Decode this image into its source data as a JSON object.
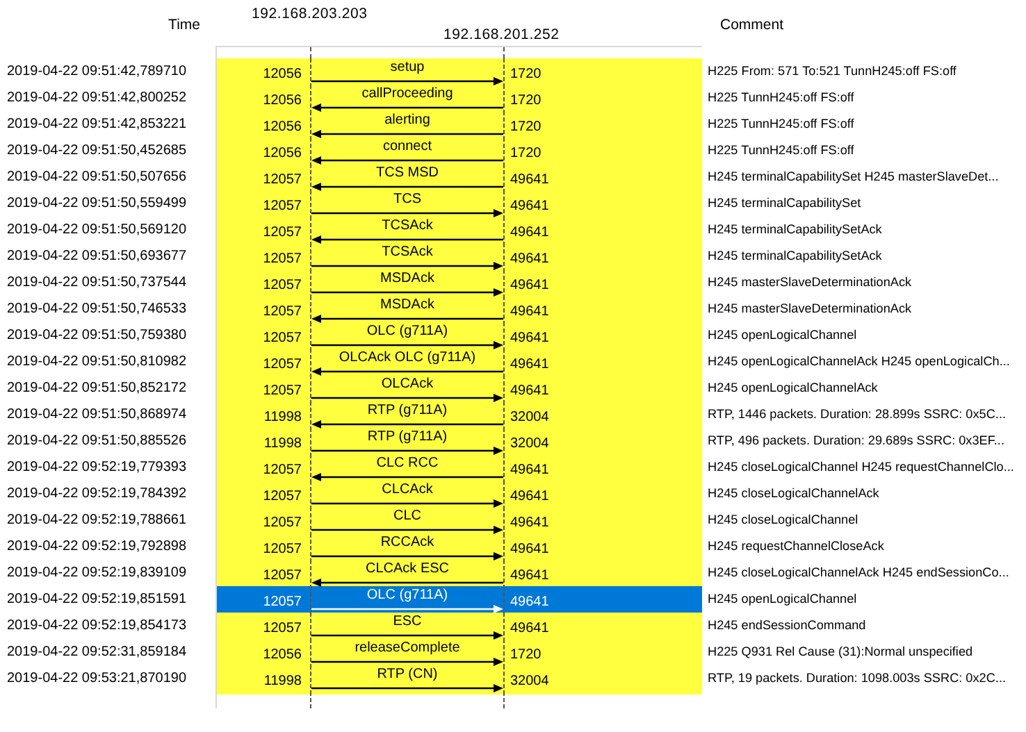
{
  "columns": {
    "time": "Time",
    "comment": "Comment"
  },
  "hosts": [
    "192.168.203.203",
    "192.168.201.252"
  ],
  "rows": [
    {
      "time": "2019-04-22 09:51:42,789710",
      "left_port": "12056",
      "label": "setup",
      "right_port": "1720",
      "kind": "right",
      "comment": "H225 From: 571 To:521  TunnH245:off FS:off",
      "selected": false
    },
    {
      "time": "2019-04-22 09:51:42,800252",
      "left_port": "12056",
      "label": "callProceeding",
      "right_port": "1720",
      "kind": "left",
      "comment": "H225 TunnH245:off FS:off",
      "selected": false
    },
    {
      "time": "2019-04-22 09:51:42,853221",
      "left_port": "12056",
      "label": "alerting",
      "right_port": "1720",
      "kind": "left",
      "comment": "H225 TunnH245:off FS:off",
      "selected": false
    },
    {
      "time": "2019-04-22 09:51:50,452685",
      "left_port": "12056",
      "label": "connect",
      "right_port": "1720",
      "kind": "left",
      "comment": "H225 TunnH245:off FS:off",
      "selected": false
    },
    {
      "time": "2019-04-22 09:51:50,507656",
      "left_port": "12057",
      "label": "TCS MSD",
      "right_port": "49641",
      "kind": "left",
      "comment": "H245 terminalCapabilitySet H245 masterSlaveDet...",
      "selected": false
    },
    {
      "time": "2019-04-22 09:51:50,559499",
      "left_port": "12057",
      "label": "TCS",
      "right_port": "49641",
      "kind": "right",
      "comment": "H245 terminalCapabilitySet",
      "selected": false
    },
    {
      "time": "2019-04-22 09:51:50,569120",
      "left_port": "12057",
      "label": "TCSAck",
      "right_port": "49641",
      "kind": "left",
      "comment": "H245 terminalCapabilitySetAck",
      "selected": false
    },
    {
      "time": "2019-04-22 09:51:50,693677",
      "left_port": "12057",
      "label": "TCSAck",
      "right_port": "49641",
      "kind": "right",
      "comment": "H245 terminalCapabilitySetAck",
      "selected": false
    },
    {
      "time": "2019-04-22 09:51:50,737544",
      "left_port": "12057",
      "label": "MSDAck",
      "right_port": "49641",
      "kind": "right",
      "comment": "H245 masterSlaveDeterminationAck",
      "selected": false
    },
    {
      "time": "2019-04-22 09:51:50,746533",
      "left_port": "12057",
      "label": "MSDAck",
      "right_port": "49641",
      "kind": "left",
      "comment": "H245 masterSlaveDeterminationAck",
      "selected": false
    },
    {
      "time": "2019-04-22 09:51:50,759380",
      "left_port": "12057",
      "label": "OLC (g711A)",
      "right_port": "49641",
      "kind": "right",
      "comment": "H245 openLogicalChannel",
      "selected": false
    },
    {
      "time": "2019-04-22 09:51:50,810982",
      "left_port": "12057",
      "label": "OLCAck OLC (g711A)",
      "right_port": "49641",
      "kind": "left",
      "comment": "H245 openLogicalChannelAck H245 openLogicalCh...",
      "selected": false
    },
    {
      "time": "2019-04-22 09:51:50,852172",
      "left_port": "12057",
      "label": "OLCAck",
      "right_port": "49641",
      "kind": "right",
      "comment": "H245 openLogicalChannelAck",
      "selected": false
    },
    {
      "time": "2019-04-22 09:51:50,868974",
      "left_port": "11998",
      "label": "RTP (g711A)",
      "right_port": "32004",
      "kind": "left",
      "comment": "RTP, 1446 packets. Duration: 28.899s SSRC: 0x5C...",
      "selected": false
    },
    {
      "time": "2019-04-22 09:51:50,885526",
      "left_port": "11998",
      "label": "RTP (g711A)",
      "right_port": "32004",
      "kind": "right",
      "comment": "RTP, 496 packets. Duration: 29.689s SSRC: 0x3EF...",
      "selected": false
    },
    {
      "time": "2019-04-22 09:52:19,779393",
      "left_port": "12057",
      "label": "CLC RCC",
      "right_port": "49641",
      "kind": "left",
      "comment": "H245 closeLogicalChannel H245 requestChannelClo...",
      "selected": false
    },
    {
      "time": "2019-04-22 09:52:19,784392",
      "left_port": "12057",
      "label": "CLCAck",
      "right_port": "49641",
      "kind": "right",
      "comment": "H245 closeLogicalChannelAck",
      "selected": false
    },
    {
      "time": "2019-04-22 09:52:19,788661",
      "left_port": "12057",
      "label": "CLC",
      "right_port": "49641",
      "kind": "right",
      "comment": "H245 closeLogicalChannel",
      "selected": false
    },
    {
      "time": "2019-04-22 09:52:19,792898",
      "left_port": "12057",
      "label": "RCCAck",
      "right_port": "49641",
      "kind": "right",
      "comment": "H245 requestChannelCloseAck",
      "selected": false
    },
    {
      "time": "2019-04-22 09:52:19,839109",
      "left_port": "12057",
      "label": "CLCAck ESC",
      "right_port": "49641",
      "kind": "left",
      "comment": "H245 closeLogicalChannelAck H245 endSessionCo...",
      "selected": false
    },
    {
      "time": "2019-04-22 09:52:19,851591",
      "left_port": "12057",
      "label": "OLC (g711A)",
      "right_port": "49641",
      "kind": "right",
      "comment": "H245 openLogicalChannel",
      "selected": true
    },
    {
      "time": "2019-04-22 09:52:19,854173",
      "left_port": "12057",
      "label": "ESC",
      "right_port": "49641",
      "kind": "right",
      "comment": "H245 endSessionCommand",
      "selected": false
    },
    {
      "time": "2019-04-22 09:52:31,859184",
      "left_port": "12056",
      "label": "releaseComplete",
      "right_port": "1720",
      "kind": "right",
      "comment": "H225 Q931 Rel Cause (31):Normal unspecified",
      "selected": false
    },
    {
      "time": "2019-04-22 09:53:21,870190",
      "left_port": "11998",
      "label": "RTP (CN)",
      "right_port": "32004",
      "kind": "right",
      "comment": "RTP, 19 packets. Duration: 1098.003s SSRC: 0x2C...",
      "selected": false
    }
  ]
}
